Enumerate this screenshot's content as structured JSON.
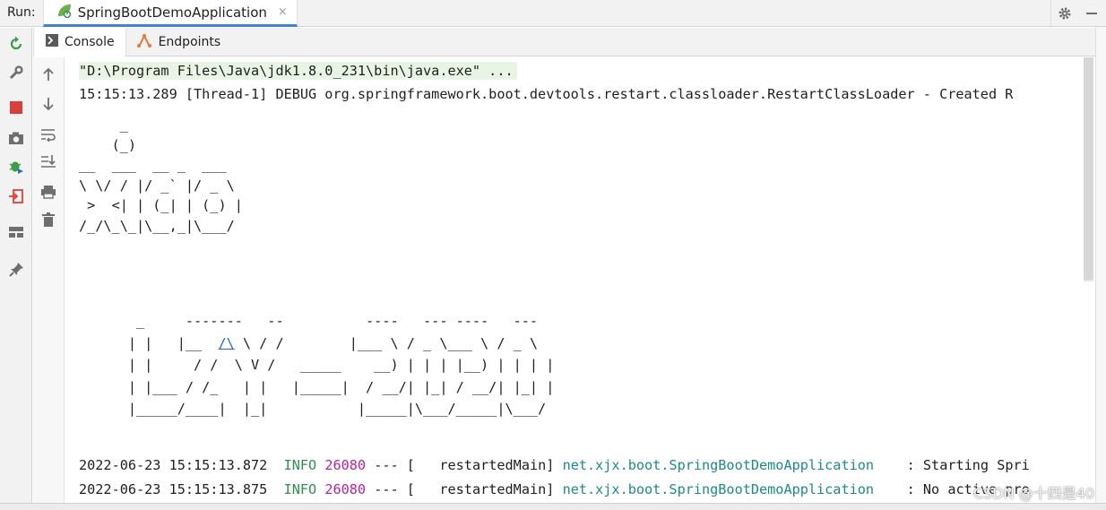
{
  "run_header": {
    "label": "Run:",
    "tab_title": "SpringBootDemoApplication",
    "close_glyph": "×"
  },
  "tabs": [
    {
      "label": "Console",
      "icon": "console-icon"
    },
    {
      "label": "Endpoints",
      "icon": "endpoints-icon"
    }
  ],
  "left_toolbar": [
    "rerun-icon",
    "wrench-icon",
    "stop-icon",
    "camera-icon",
    "debug-icon",
    "exit-icon",
    "layout-icon",
    "pin-icon"
  ],
  "second_toolbar": [
    "up-arrow-icon",
    "down-arrow-icon",
    "soft-wrap-icon",
    "scroll-to-end-icon",
    "print-icon",
    "trash-icon"
  ],
  "console": {
    "command_line": "\"D:\\Program Files\\Java\\jdk1.8.0_231\\bin\\java.exe\" ...",
    "debug_line": "15:15:13.289 [Thread-1] DEBUG org.springframework.boot.devtools.restart.classloader.RestartClassLoader - Created R",
    "banner_xjx": "     _\n    (_)\n__  ___  __ _  ___\n\\ \\/ / |/ _` |/ _ \\\n >  <| | (_| | (_) |\n/_/\\_\\_|\\__,_|\\___/",
    "banner_row1": "       _     -------   --          ----   --- ----   ---",
    "banner_row2_a": "      | |   |__  ",
    "banner_row2_link": "/\\",
    "banner_row2_b": " \\ / /        |___ \\ / _ \\___ \\ / _ \\",
    "banner_row3": "      | |     / /  \\ V /   _____    __) | | | |__) | | | |",
    "banner_row4": "      | |___ / /_   | |   |_____|  / __/| |_| / __/| |_| |",
    "banner_row5": "      |_____/____|  |_|           |_____|\\___/_____|\\___/",
    "log_lines": [
      {
        "timestamp": "2022-06-23 15:15:13.872",
        "level": "INFO",
        "pid": "26080",
        "sep": "--- [",
        "thread": "  restartedMain]",
        "logger": "net.xjx.boot.SpringBootDemoApplication",
        "message": "   : Starting Spri"
      },
      {
        "timestamp": "2022-06-23 15:15:13.875",
        "level": "INFO",
        "pid": "26080",
        "sep": "--- [",
        "thread": "  restartedMain]",
        "logger": "net.xjx.boot.SpringBootDemoApplication",
        "message": "   : No active pro"
      }
    ]
  },
  "watermark": "CSDN @十四是40",
  "colors": {
    "info": "#2f8f4e",
    "pid": "#b6239f",
    "logger": "#1c8a8c",
    "tab_underline": "#4083c9"
  }
}
